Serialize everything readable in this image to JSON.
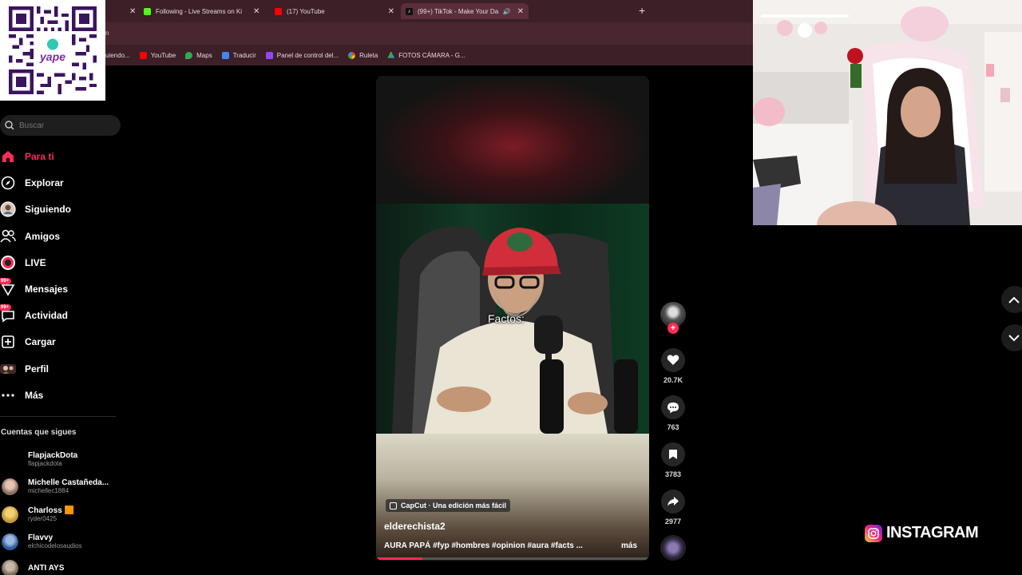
{
  "browser": {
    "tabs": [
      {
        "title": "",
        "color": "#3c1f27"
      },
      {
        "title": "Following - Live Streams on Ki",
        "color": "#53fc18"
      },
      {
        "title": "(17) YouTube",
        "color": "#ff0000"
      },
      {
        "title": "(99+) TikTok - Make Your Da",
        "color": "#ffffff",
        "active": true
      }
    ],
    "address_fragment": "n",
    "bookmarks": [
      {
        "label": "uiendo...",
        "color": "#555555"
      },
      {
        "label": "YouTube",
        "color": "#ff0000"
      },
      {
        "label": "Maps",
        "color": "#34a853"
      },
      {
        "label": "Traducir",
        "color": "#4285f4"
      },
      {
        "label": "Panel de control del...",
        "color": "#9146ff"
      },
      {
        "label": "Ruleta",
        "color": "#ea4335"
      },
      {
        "label": "FOTOS CÁMARA - G...",
        "color": "#fbbc05"
      }
    ]
  },
  "overlay": {
    "qr_brand": "yape"
  },
  "sidebar": {
    "search_placeholder": "Buscar",
    "nav": [
      {
        "label": "Para ti",
        "icon": "home-icon",
        "active": true
      },
      {
        "label": "Explorar",
        "icon": "compass-icon"
      },
      {
        "label": "Siguiendo",
        "icon": "following-avatar-icon"
      },
      {
        "label": "Amigos",
        "icon": "friends-icon"
      },
      {
        "label": "LIVE",
        "icon": "live-icon"
      },
      {
        "label": "Mensajes",
        "icon": "messages-icon",
        "badge": "99+"
      },
      {
        "label": "Actividad",
        "icon": "activity-icon",
        "badge": "99+"
      },
      {
        "label": "Cargar",
        "icon": "upload-icon"
      },
      {
        "label": "Perfil",
        "icon": "profile-icon"
      },
      {
        "label": "Más",
        "icon": "more-icon"
      }
    ],
    "following_title": "Cuentas que sigues",
    "accounts": [
      {
        "name": "FlapjackDota",
        "handle": "flapjackdota",
        "color": "#000000"
      },
      {
        "name": "Michelle Castañeda...",
        "handle": "michellec1884",
        "color": "#8a6f62"
      },
      {
        "name": "Charloss 🟧",
        "handle": "ryder0425",
        "color": "#c49a3a"
      },
      {
        "name": "Flavvy",
        "handle": "elchicodelosaudios",
        "color": "#2d5b9a"
      },
      {
        "name": "ANTI AYS",
        "handle": "",
        "color": "#7a6a5a"
      }
    ]
  },
  "video": {
    "subtitle": "Factos:",
    "capcut_label": "CapCut · Una edición más fácil",
    "author": "elderechista2",
    "description": "AURA PAPÁ #fyp #hombres #opinion #aura #facts ...",
    "more_label": "más",
    "progress": 0.17
  },
  "actions": {
    "likes": "20.7K",
    "comments": "763",
    "saves": "3783",
    "shares": "2977"
  },
  "instagram_label": "INSTAGRAM"
}
